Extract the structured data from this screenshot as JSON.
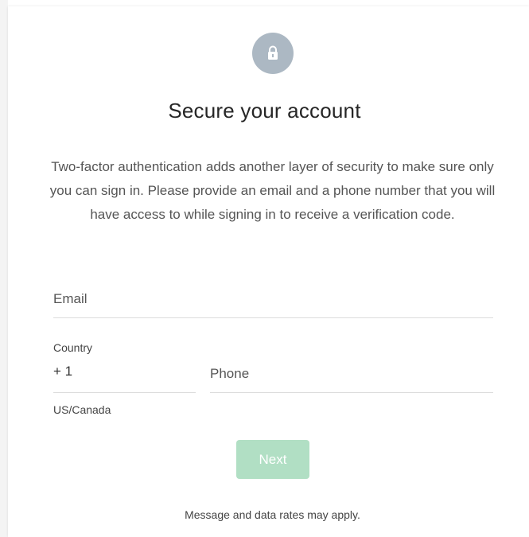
{
  "header": {
    "icon": "lock-icon",
    "title": "Secure your account",
    "description": "Two-factor authentication adds another layer of security to make sure only you can sign in. Please provide an email and a phone number that you will have access to while signing in to receive a verification code."
  },
  "form": {
    "email": {
      "placeholder": "Email",
      "value": ""
    },
    "country": {
      "label": "Country",
      "value": "+ 1",
      "region": "US/Canada"
    },
    "phone": {
      "placeholder": "Phone",
      "value": ""
    },
    "next_label": "Next"
  },
  "footer": {
    "note": "Message and data rates may apply."
  },
  "colors": {
    "lock_circle": "#acb8c3",
    "next_button": "#b1dfc4",
    "divider": "#dcdcdc"
  }
}
